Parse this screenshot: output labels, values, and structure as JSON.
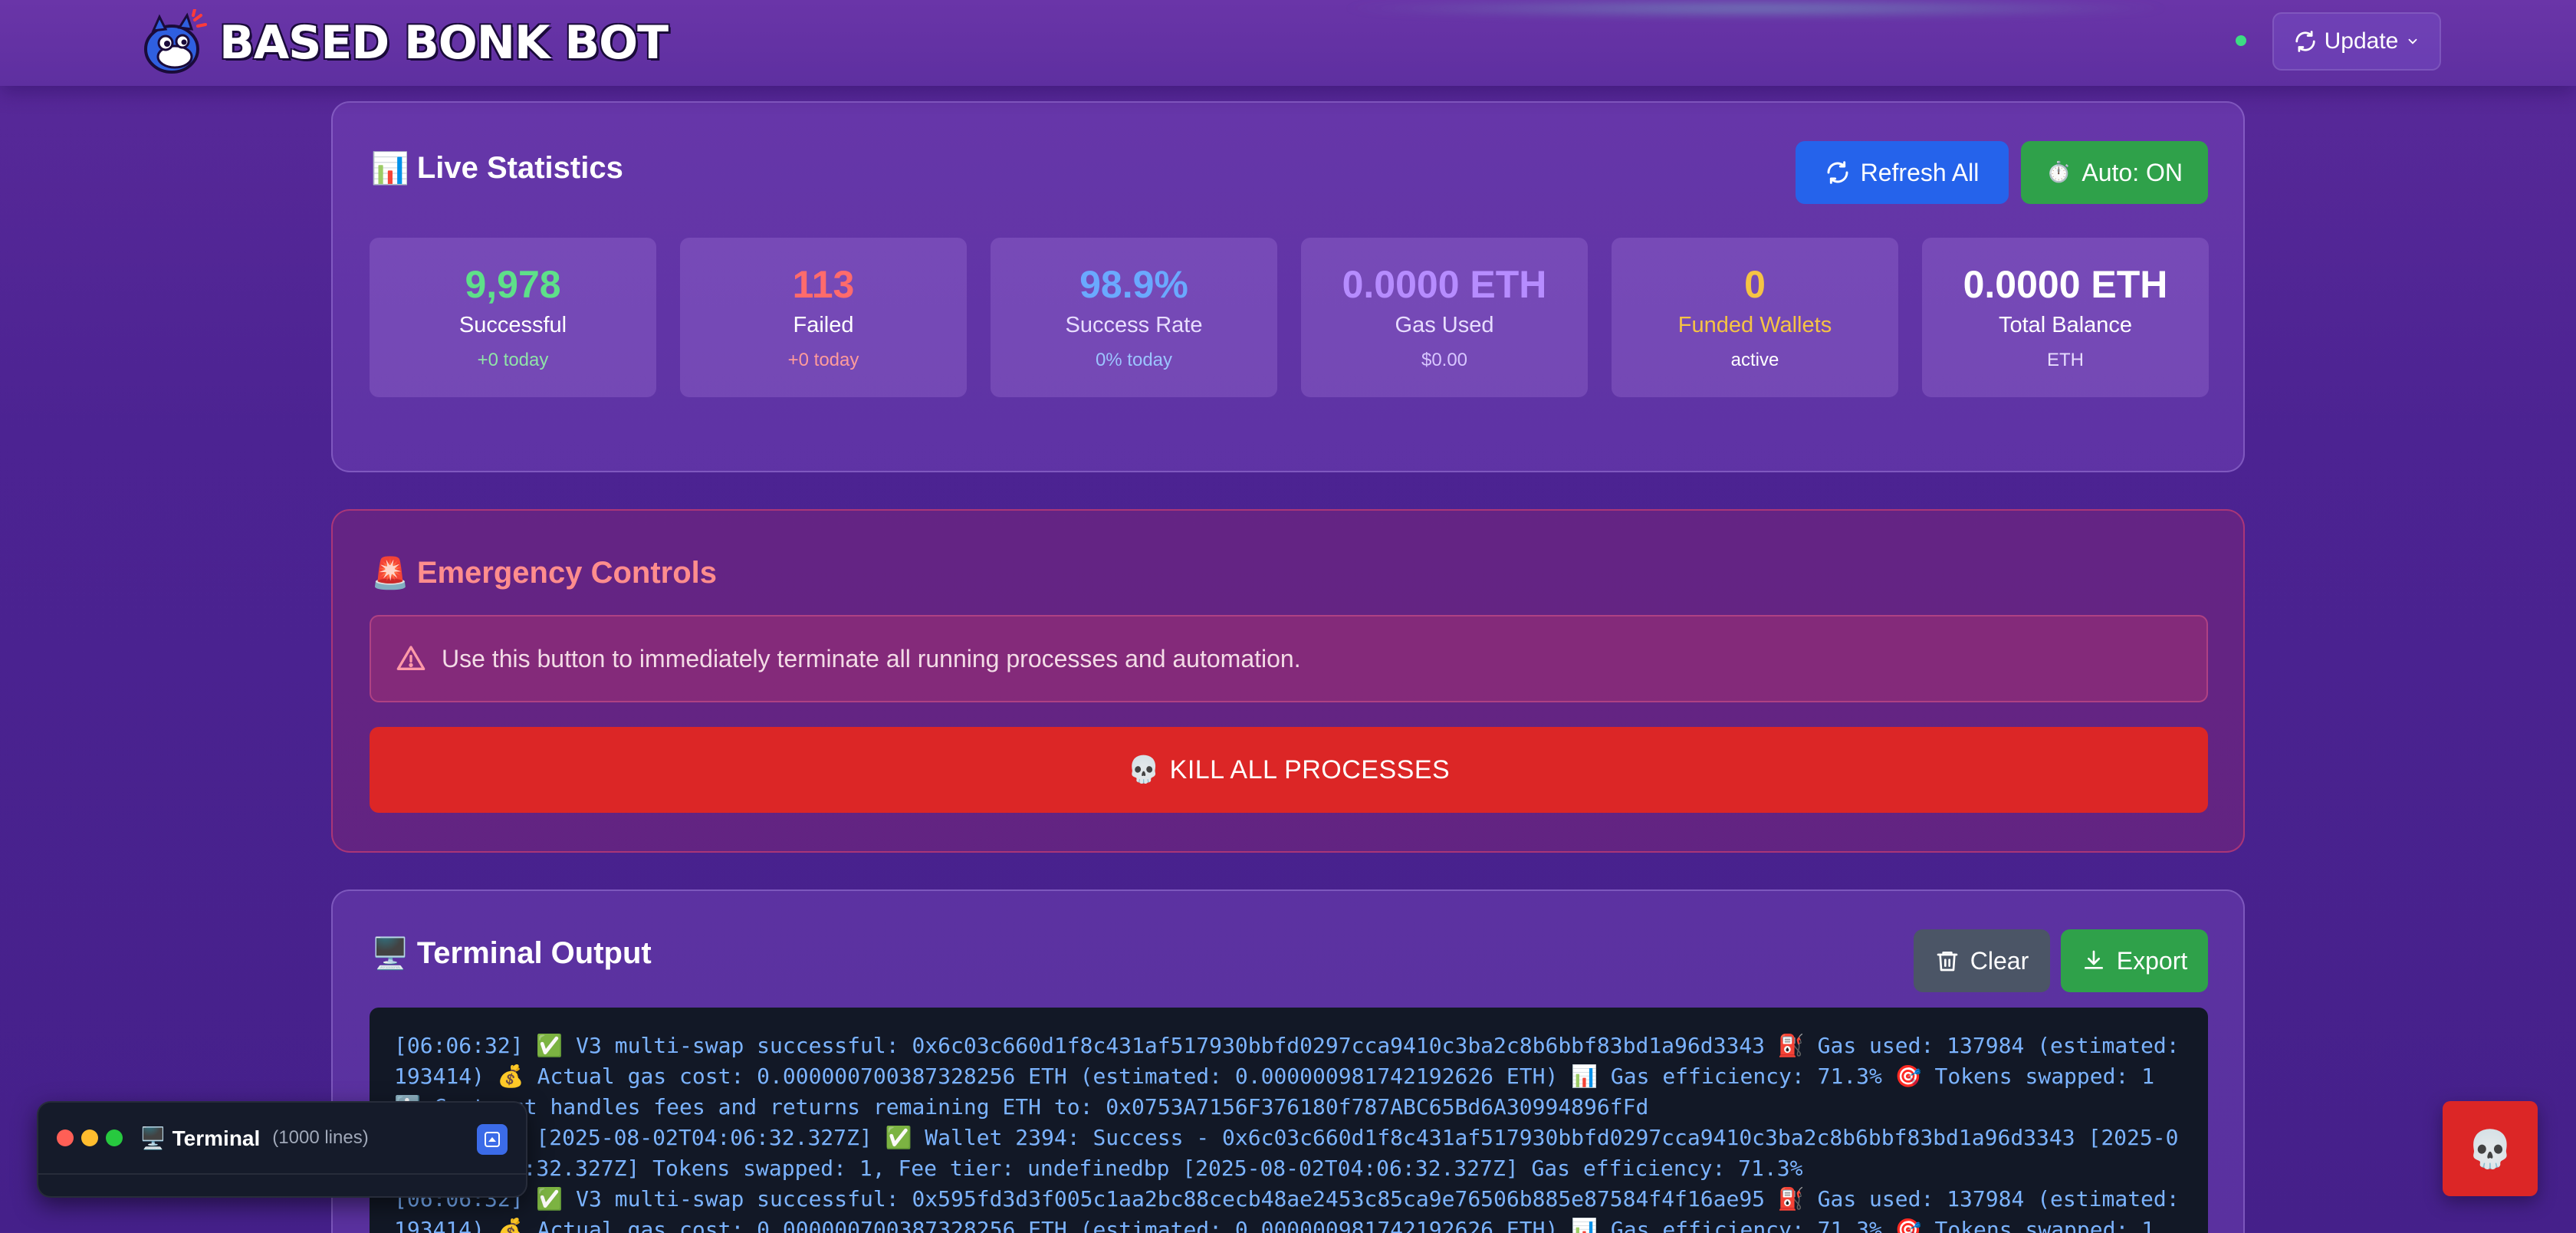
{
  "header": {
    "logo_text": "BASED BONK BOT",
    "update_label": "Update",
    "status_color": "#3ddc84"
  },
  "stats": {
    "title": "Live Statistics",
    "title_icon": "📊",
    "refresh_label": "Refresh All",
    "auto_label": "Auto: ON",
    "auto_icon": "⏱️",
    "tiles": [
      {
        "value": "9,978",
        "label": "Successful",
        "sub": "+0 today",
        "color": "#5ee089"
      },
      {
        "value": "113",
        "label": "Failed",
        "sub": "+0 today",
        "color": "#ff6b6b"
      },
      {
        "value": "98.9%",
        "label": "Success Rate",
        "sub": "0% today",
        "color": "#6aa9ff"
      },
      {
        "value": "0.0000 ETH",
        "label": "Gas Used",
        "sub": "$0.00",
        "color": "#b68cff"
      },
      {
        "value": "0",
        "label": "Funded Wallets",
        "sub": "active",
        "color": "#f6c344"
      },
      {
        "value": "0.0000 ETH",
        "label": "Total Balance",
        "sub": "ETH",
        "color": "#ffffff"
      }
    ]
  },
  "emergency": {
    "title": "Emergency Controls",
    "title_icon": "🚨",
    "warning": "Use this button to immediately terminate all running processes and automation.",
    "kill_label": "KILL ALL PROCESSES",
    "kill_icon": "💀"
  },
  "terminal": {
    "title": "Terminal Output",
    "title_icon": "🖥️",
    "clear_label": "Clear",
    "export_label": "Export",
    "log": "[06:06:32] ✅ V3 multi-swap successful: 0x6c03c660d1f8c431af517930bbfd0297cca9410c3ba2c8b6bbf83bd1a96d3343 ⛽ Gas used: 137984 (estimated: 193414) 💰 Actual gas cost: 0.000000700387328256 ETH (estimated: 0.000000981742192626 ETH) 📊 Gas efficiency: 71.3% 🎯 Tokens swapped: 1 ℹ️ Contract handles fees and returns remaining ETH to: 0x0753A7156F376180f787ABC65Bd6A30994896fFd\n[06:06:32] [2025-08-02T04:06:32.327Z] ✅ Wallet 2394: Success - 0x6c03c660d1f8c431af517930bbfd0297cca9410c3ba2c8b6bbf83bd1a96d3343 [2025-08-02T04:06:32.327Z] Tokens swapped: 1, Fee tier: undefinedbp [2025-08-02T04:06:32.327Z] Gas efficiency: 71.3%\n[06:06:32] ✅ V3 multi-swap successful: 0x595fd3d3f005c1aa2bc88cecb48ae2453c85ca9e76506b885e87584f4f16ae95 ⛽ Gas used: 137984 (estimated: 193414) 💰 Actual gas cost: 0.000000700387328256 ETH (estimated: 0.000000981742192626 ETH) 📊 Gas efficiency: 71.3% 🎯 Tokens swapped: 1"
  },
  "mini_terminal": {
    "title": "Terminal",
    "title_icon": "🖥️",
    "lines": "(1000 lines)"
  },
  "fab": {
    "icon": "💀"
  }
}
